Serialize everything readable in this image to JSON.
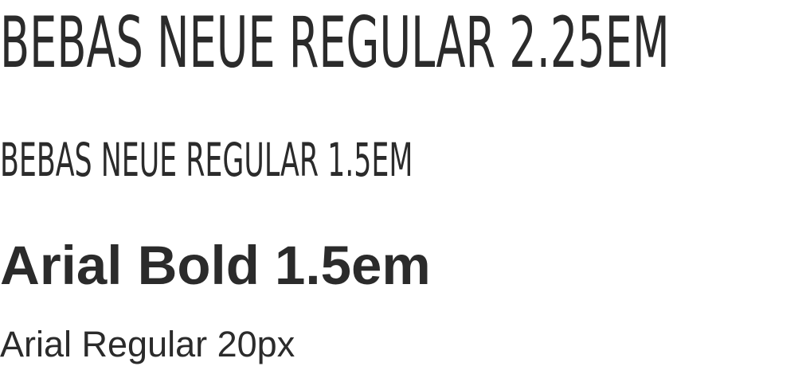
{
  "samples": [
    {
      "text": "BEBAS NEUE REGULAR 2.25EM"
    },
    {
      "text": "BEBAS NEUE REGULAR 1.5EM"
    },
    {
      "text": "Arial Bold 1.5em"
    },
    {
      "text": "Arial Regular 20px"
    }
  ],
  "colors": {
    "text": "#2b2b2b",
    "background": "#ffffff"
  }
}
